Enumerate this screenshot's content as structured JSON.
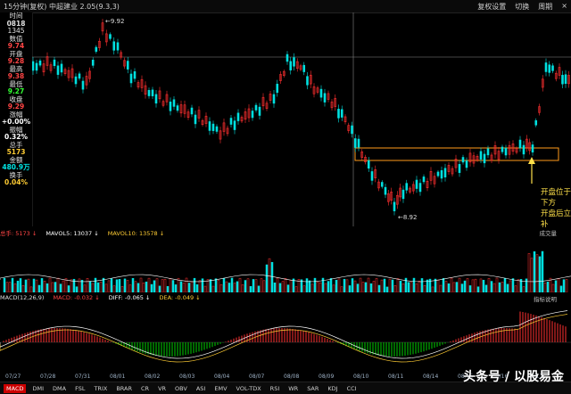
{
  "window": {
    "title": "15分钟(复权)  中超建业  2.05(9.3,3)"
  },
  "topright": [
    "复权设置",
    "切换",
    "周期",
    "×"
  ],
  "info_panel": {
    "items": [
      {
        "label": "时间",
        "value": "0818",
        "color": "#e0e0e0"
      },
      {
        "label": "1345",
        "value": "",
        "color": "#e0e0e0"
      },
      {
        "label": "数值",
        "value": "9.74",
        "color": "#ff4545"
      },
      {
        "label": "开盘",
        "value": "9.28",
        "color": "#ff4545"
      },
      {
        "label": "最高",
        "value": "9.38",
        "color": "#ff4545"
      },
      {
        "label": "最低",
        "value": "9.27",
        "color": "#32ff32"
      },
      {
        "label": "收盘",
        "value": "9.29",
        "color": "#ff4545"
      },
      {
        "label": "涨幅",
        "value": "+0.00%",
        "color": "#ffffff"
      },
      {
        "label": "振幅",
        "value": "0.32%",
        "color": "#ffffff"
      },
      {
        "label": "总手",
        "value": "5173",
        "color": "#ffcc33"
      },
      {
        "label": "金额",
        "value": "480.9万",
        "color": "#00e6e6"
      },
      {
        "label": "换手",
        "value": "0.04%",
        "color": "#ffcc33"
      }
    ]
  },
  "main_chart": {
    "high_label": "9.92",
    "low_label": "8.92",
    "annotation": [
      "开盘位于缺口",
      "下方",
      "开盘后立即回",
      "补"
    ],
    "colors": {
      "up": "#ff3030",
      "down": "#00e0e0",
      "grid": "#2a2a2a"
    }
  },
  "volume": {
    "labels": [
      "总手: 5173 ↓",
      "MAVOL5: 13037 ↓",
      "MAVOL10: 13578 ↓"
    ],
    "right_label": "成交量"
  },
  "macd": {
    "labels": [
      "MACD(12,26,9)",
      "MACD: -0.032 ↓",
      "DIFF: -0.065 ↓",
      "DEA: -0.049 ↓"
    ],
    "right_label": "指标说明"
  },
  "date_axis": [
    "07/27",
    "07/28",
    "07/31",
    "08/01",
    "08/02",
    "08/03",
    "08/04",
    "08/07",
    "08/08",
    "08/09",
    "08/10",
    "08/11",
    "08/14",
    "08/15",
    "08/16",
    "08/17"
  ],
  "tabs": [
    "MACD",
    "DMI",
    "DMA",
    "FSL",
    "TRIX",
    "BRAR",
    "CR",
    "VR",
    "OBV",
    "ASI",
    "EMV",
    "VOL-TDX",
    "RSI",
    "WR",
    "SAR",
    "KDJ",
    "CCI"
  ],
  "watermark": "头条号 / 以股易金"
}
